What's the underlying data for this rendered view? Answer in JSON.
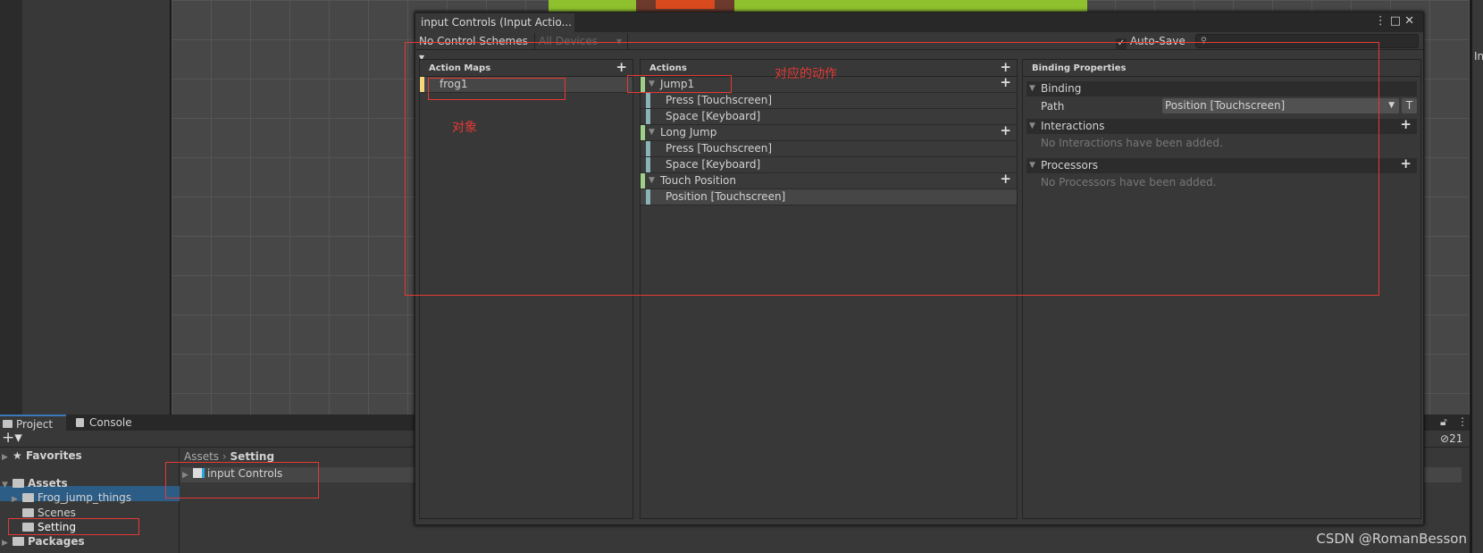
{
  "window": {
    "title": "input Controls (Input Actio...",
    "control_schemes": "No Control Schemes",
    "devices": "All Devices",
    "auto_save_label": "Auto-Save",
    "auto_save_checked": true,
    "search_placeholder": "",
    "menu_icon": "⋮",
    "maximize_icon": "□",
    "close_icon": "✕"
  },
  "action_maps": {
    "header": "Action Maps",
    "items": [
      {
        "label": "frog1",
        "color": "#f5d77d"
      }
    ]
  },
  "actions": {
    "header": "Actions",
    "items": [
      {
        "label": "Jump1",
        "bindings": [
          "Press [Touchscreen]",
          "Space [Keyboard]"
        ]
      },
      {
        "label": "Long Jump",
        "bindings": [
          "Press [Touchscreen]",
          "Space [Keyboard]"
        ]
      },
      {
        "label": "Touch Position",
        "bindings": [
          "Position [Touchscreen]"
        ]
      }
    ],
    "action_color": "#9fd08a",
    "binding_color": "#8ab3b8"
  },
  "binding_properties": {
    "header": "Binding Properties",
    "binding_section": "Binding",
    "path_label": "Path",
    "path_value": "Position [Touchscreen]",
    "t_button": "T",
    "interactions_section": "Interactions",
    "interactions_note": "No Interactions have been added.",
    "processors_section": "Processors",
    "processors_note": "No Processors have been added."
  },
  "annotations": {
    "object": "对象",
    "action": "对应的动作"
  },
  "project": {
    "tabs": [
      "Project",
      "Console"
    ],
    "tree": {
      "favorites": "Favorites",
      "assets": "Assets",
      "folders": [
        "Frog_jump_things",
        "Scenes",
        "Setting"
      ],
      "packages": "Packages"
    },
    "breadcrumb": [
      "Assets",
      "Setting"
    ],
    "asset": "input Controls",
    "hidden_count": "21"
  },
  "right_panel_label": "In",
  "watermark": "CSDN @RomanBesson"
}
